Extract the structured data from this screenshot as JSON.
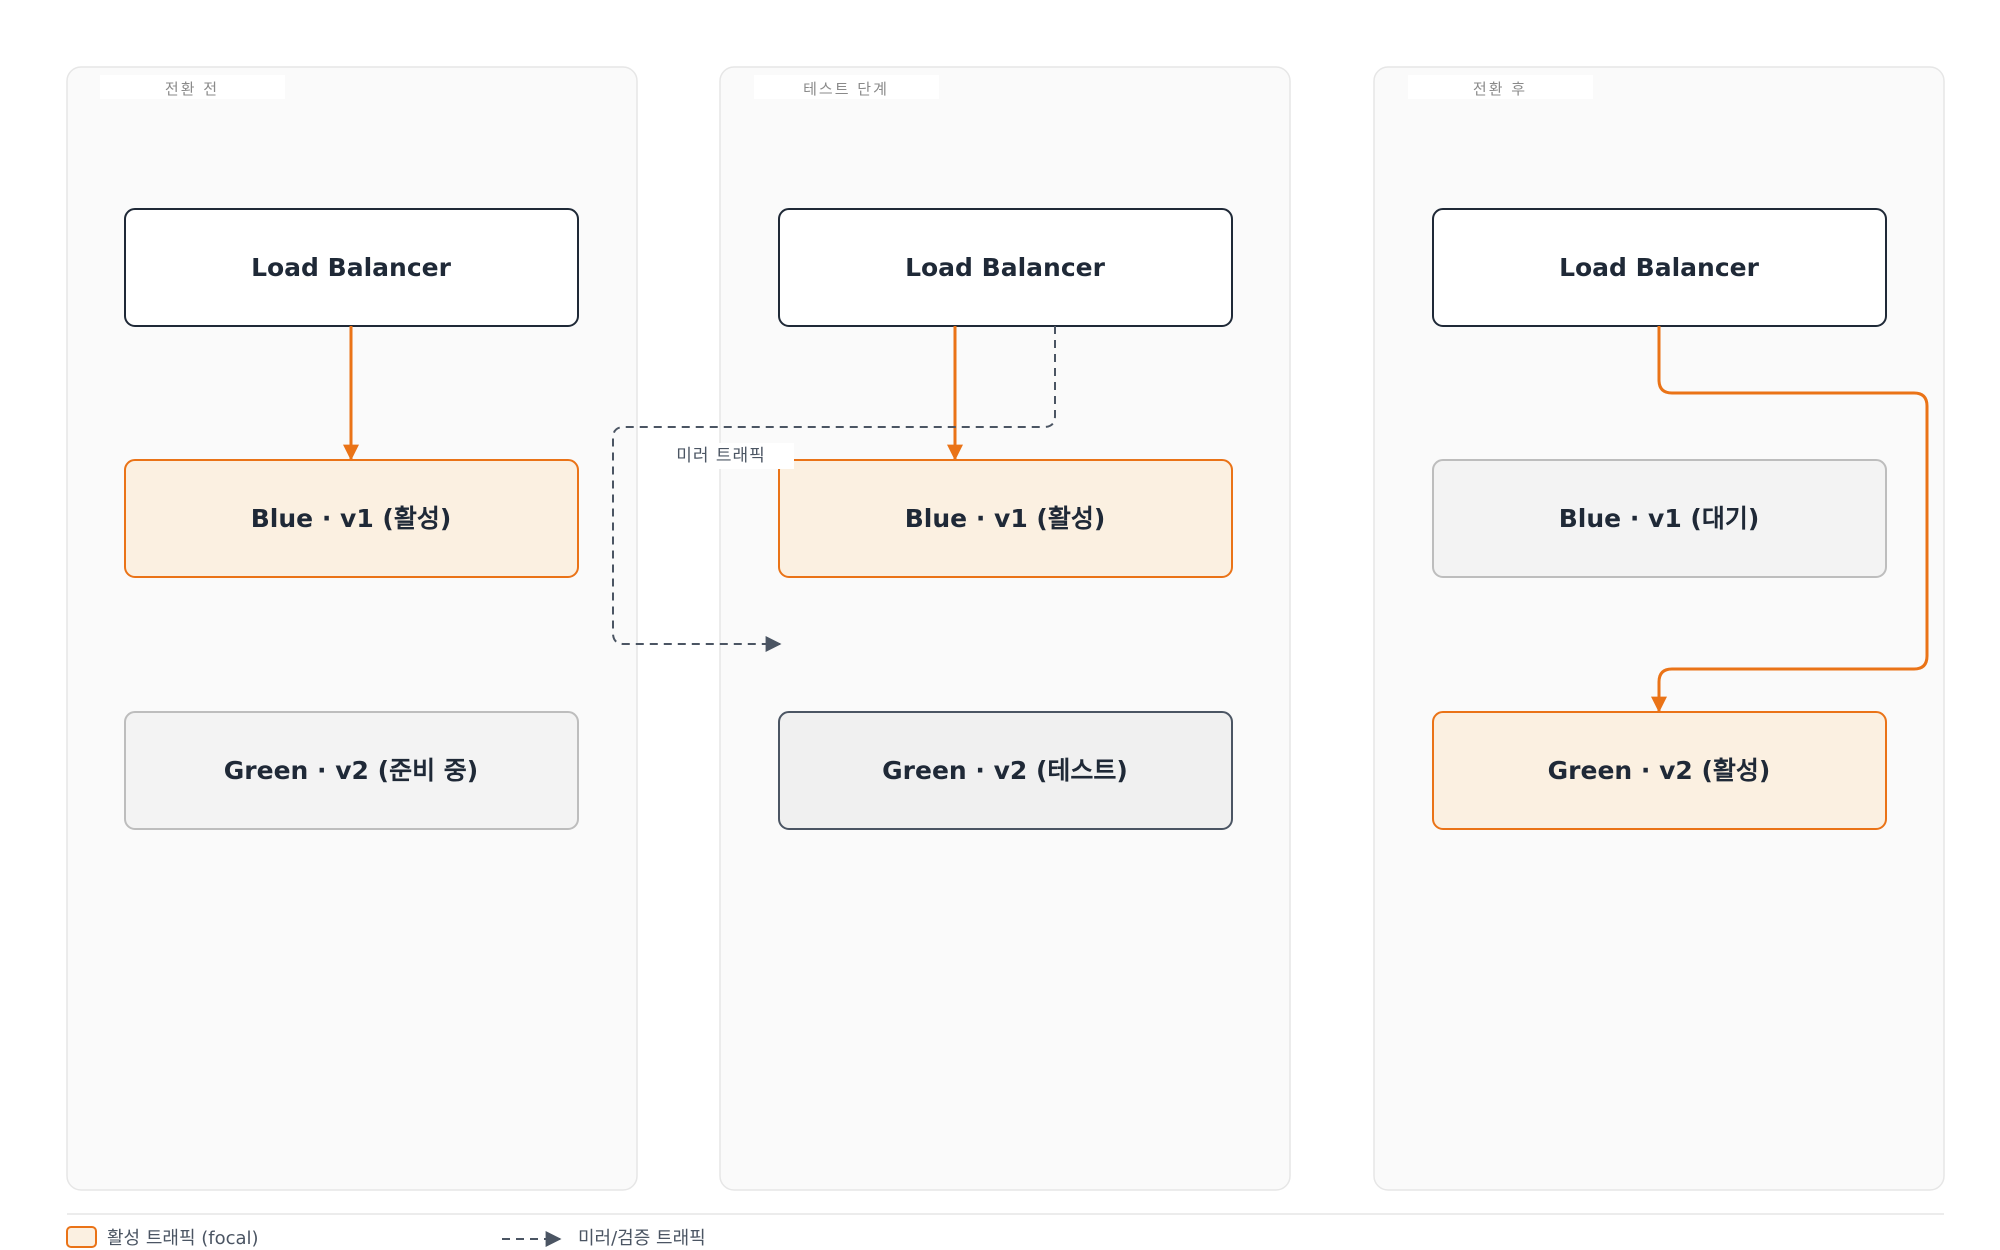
{
  "colors": {
    "active": "#ea7317",
    "active_fill": "#fbf0e1",
    "ink": "#1f2937",
    "standby_border": "#bdbdbd",
    "standby_fill": "#f3f3f3",
    "test_border": "#4b5563",
    "test_fill": "#f0f0f0",
    "panel_fill": "#fafafa",
    "panel_border": "#e6e6e6",
    "mirror": "#4b5563"
  },
  "panels": [
    {
      "title": "전환 전",
      "load_balancer": "Load Balancer",
      "blue": "Blue · v1 (활성)",
      "green": "Green · v2 (준비 중)"
    },
    {
      "title": "테스트 단계",
      "load_balancer": "Load Balancer",
      "blue": "Blue · v1 (활성)",
      "green": "Green · v2 (테스트)",
      "mirror_label": "미러 트래픽"
    },
    {
      "title": "전환 후",
      "load_balancer": "Load Balancer",
      "blue": "Blue · v1 (대기)",
      "green": "Green · v2 (활성)"
    }
  ],
  "legend": {
    "active": "활성 트래픽 (focal)",
    "mirror": "미러/검증 트래픽"
  }
}
